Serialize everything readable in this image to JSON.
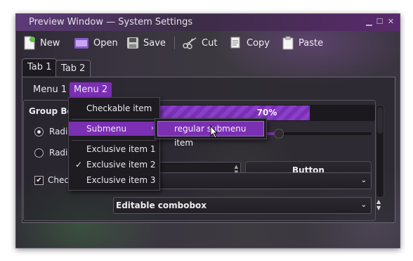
{
  "window": {
    "title": "Preview Window — System Settings"
  },
  "toolbar": {
    "new_label": "New",
    "open_label": "Open",
    "save_label": "Save",
    "cut_label": "Cut",
    "copy_label": "Copy",
    "paste_label": "Paste"
  },
  "tabs": [
    {
      "label": "Tab 1"
    },
    {
      "label": "Tab 2"
    }
  ],
  "menubar": [
    {
      "label": "Menu 1"
    },
    {
      "label": "Menu 2"
    }
  ],
  "groupbox": {
    "title": "Group Box",
    "radio1_label": "Radio button",
    "radio2_label": "Radio button",
    "checkbox_label": "Checkbox"
  },
  "progress": {
    "value_percent": 70,
    "text": "70%"
  },
  "slider": {
    "value_fraction": 0.56
  },
  "button": {
    "label": "Button"
  },
  "combo_editable": {
    "value": "Editable combobox"
  },
  "menu": {
    "checkable": "Checkable item",
    "submenu": "Submenu",
    "exclusive1": "Exclusive item 1",
    "exclusive2": "Exclusive item 2",
    "exclusive3": "Exclusive item 3"
  },
  "submenu": {
    "item": "regular submenu item"
  },
  "colors": {
    "accent": "#7b2fb3",
    "titlebar": "#5d3b78"
  },
  "icons": [
    "new-document-icon",
    "open-folder-icon",
    "save-disk-icon",
    "scissors-icon",
    "copy-icon",
    "paste-clipboard-icon",
    "minimize-icon",
    "maximize-icon",
    "close-icon",
    "chevron-down-icon",
    "checkmark-icon",
    "chevron-right-icon"
  ]
}
